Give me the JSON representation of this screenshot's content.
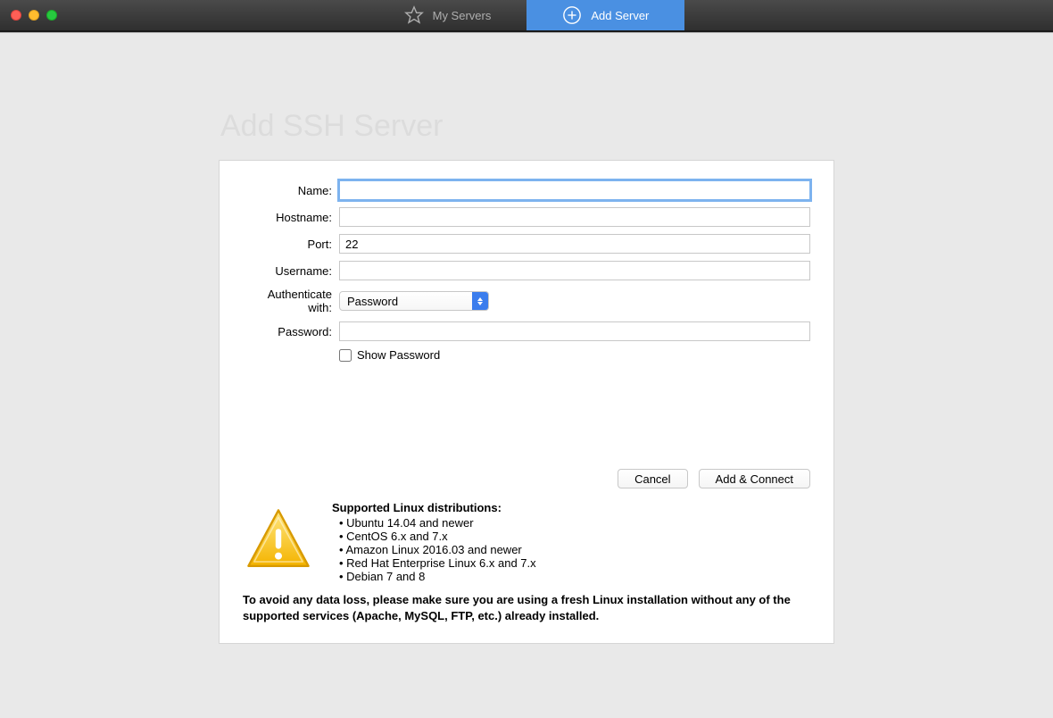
{
  "tabs": {
    "my_servers": "My Servers",
    "add_server": "Add Server"
  },
  "page": {
    "title": "Add SSH Server"
  },
  "form": {
    "name_label": "Name:",
    "name_value": "",
    "hostname_label": "Hostname:",
    "hostname_value": "",
    "port_label": "Port:",
    "port_value": "22",
    "username_label": "Username:",
    "username_value": "",
    "auth_label": "Authenticate with:",
    "auth_selected": "Password",
    "password_label": "Password:",
    "password_value": "",
    "show_password_label": "Show Password"
  },
  "buttons": {
    "cancel": "Cancel",
    "add_connect": "Add & Connect"
  },
  "info": {
    "distro_title": "Supported Linux distributions:",
    "distros": {
      "0": "Ubuntu 14.04 and newer",
      "1": "CentOS 6.x and 7.x",
      "2": "Amazon Linux 2016.03 and newer",
      "3": "Red Hat Enterprise Linux 6.x and 7.x",
      "4": "Debian 7 and 8"
    },
    "warning": "To avoid any data loss, please make sure you are using a fresh Linux installation without any of the supported services (Apache, MySQL, FTP, etc.) already installed."
  }
}
